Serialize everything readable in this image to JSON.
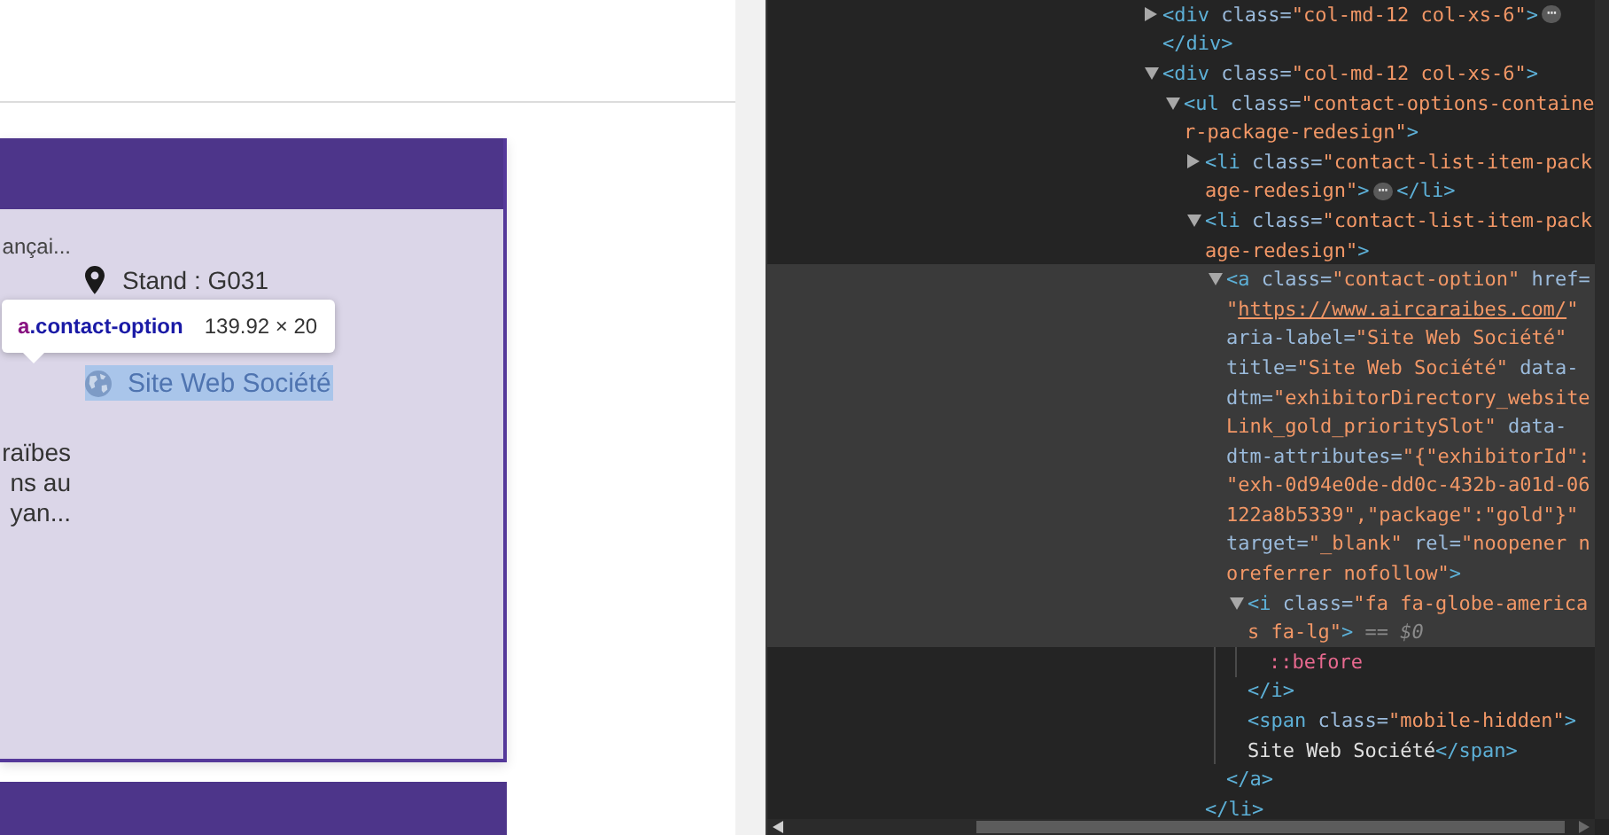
{
  "page": {
    "card": {
      "left_fragment": "ançai...",
      "description_lines": [
        "raïbes",
        "ns au",
        "yan..."
      ],
      "stand": "Stand : G031",
      "website": {
        "label": "Site Web Société",
        "highlighted": true
      }
    },
    "tooltip": {
      "selector_tag": "a",
      "selector_class": ".contact-option",
      "size": "139.92 × 20"
    }
  },
  "devtools": {
    "tree": [
      {
        "kind": "node",
        "expanded": false,
        "highlighted": false,
        "lines": [
          [
            {
              "kind": "tag",
              "text": "<div"
            },
            {
              "kind": "attr",
              "text": " class="
            },
            {
              "kind": "value",
              "text": "\"col-md-12 col-xs-6\""
            },
            {
              "kind": "tag",
              "text": ">"
            },
            {
              "kind": "badge",
              "text": "⋯"
            }
          ],
          [
            {
              "kind": "tag",
              "text": "</div>"
            }
          ]
        ]
      },
      {
        "kind": "node",
        "expanded": true,
        "highlighted": false,
        "lines": [
          [
            {
              "kind": "tag",
              "text": "<div"
            },
            {
              "kind": "attr",
              "text": " class="
            },
            {
              "kind": "value",
              "text": "\"col-md-12 col-xs-6\""
            },
            {
              "kind": "tag",
              "text": ">"
            }
          ]
        ],
        "children": [
          {
            "kind": "node",
            "expanded": true,
            "highlighted": false,
            "lines": [
              [
                {
                  "kind": "tag",
                  "text": "<ul"
                },
                {
                  "kind": "attr",
                  "text": " class="
                },
                {
                  "kind": "value",
                  "text": "\"contact-options-containe"
                }
              ],
              [
                {
                  "kind": "value",
                  "text": "r-package-redesign\""
                },
                {
                  "kind": "tag",
                  "text": ">"
                }
              ]
            ],
            "children": [
              {
                "kind": "node",
                "expanded": false,
                "highlighted": false,
                "lines": [
                  [
                    {
                      "kind": "tag",
                      "text": "<li"
                    },
                    {
                      "kind": "attr",
                      "text": " class="
                    },
                    {
                      "kind": "value",
                      "text": "\"contact-list-item-pack"
                    }
                  ],
                  [
                    {
                      "kind": "value",
                      "text": "age-redesign\""
                    },
                    {
                      "kind": "tag",
                      "text": ">"
                    },
                    {
                      "kind": "badge",
                      "text": "⋯"
                    },
                    {
                      "kind": "tag",
                      "text": "</li>"
                    }
                  ]
                ]
              },
              {
                "kind": "node",
                "expanded": true,
                "highlighted": false,
                "lines": [
                  [
                    {
                      "kind": "tag",
                      "text": "<li"
                    },
                    {
                      "kind": "attr",
                      "text": " class="
                    },
                    {
                      "kind": "value",
                      "text": "\"contact-list-item-pack"
                    }
                  ],
                  [
                    {
                      "kind": "value",
                      "text": "age-redesign\""
                    },
                    {
                      "kind": "tag",
                      "text": ">"
                    }
                  ]
                ],
                "children": [
                  {
                    "kind": "node",
                    "expanded": true,
                    "highlighted": true,
                    "lines": [
                      [
                        {
                          "kind": "tag",
                          "text": "<a"
                        },
                        {
                          "kind": "attr",
                          "text": " class="
                        },
                        {
                          "kind": "value",
                          "text": "\"contact-option\""
                        },
                        {
                          "kind": "attr",
                          "text": " href="
                        }
                      ],
                      [
                        {
                          "kind": "value",
                          "text": "\""
                        },
                        {
                          "kind": "link",
                          "text": "https://www.aircaraibes.com/"
                        },
                        {
                          "kind": "value",
                          "text": "\""
                        }
                      ],
                      [
                        {
                          "kind": "attr",
                          "text": "aria-label="
                        },
                        {
                          "kind": "value",
                          "text": "\"Site Web Société\""
                        }
                      ],
                      [
                        {
                          "kind": "attr",
                          "text": "title="
                        },
                        {
                          "kind": "value",
                          "text": "\"Site Web Société\""
                        },
                        {
                          "kind": "attr",
                          "text": " data-"
                        }
                      ],
                      [
                        {
                          "kind": "attr",
                          "text": "dtm="
                        },
                        {
                          "kind": "value",
                          "text": "\"exhibitorDirectory_website"
                        }
                      ],
                      [
                        {
                          "kind": "value",
                          "text": "Link_gold_prioritySlot\""
                        },
                        {
                          "kind": "attr",
                          "text": " data-"
                        }
                      ],
                      [
                        {
                          "kind": "attr",
                          "text": "dtm-attributes="
                        },
                        {
                          "kind": "value",
                          "text": "\"{\"exhibitorId\":"
                        }
                      ],
                      [
                        {
                          "kind": "value",
                          "text": "\"exh-0d94e0de-dd0c-432b-a01d-06"
                        }
                      ],
                      [
                        {
                          "kind": "value",
                          "text": "122a8b5339\",\"package\":\"gold\"}\""
                        }
                      ],
                      [
                        {
                          "kind": "attr",
                          "text": "target="
                        },
                        {
                          "kind": "value",
                          "text": "\"_blank\""
                        },
                        {
                          "kind": "attr",
                          "text": " rel="
                        },
                        {
                          "kind": "value",
                          "text": "\"noopener n"
                        }
                      ],
                      [
                        {
                          "kind": "value",
                          "text": "oreferrer nofollow\""
                        },
                        {
                          "kind": "tag",
                          "text": ">"
                        }
                      ]
                    ],
                    "children": [
                      {
                        "kind": "node",
                        "expanded": true,
                        "highlighted": true,
                        "lines": [
                          [
                            {
                              "kind": "tag",
                              "text": "<i"
                            },
                            {
                              "kind": "attr",
                              "text": " class="
                            },
                            {
                              "kind": "value",
                              "text": "\"fa fa-globe-america"
                            }
                          ],
                          [
                            {
                              "kind": "value",
                              "text": "s fa-lg\""
                            },
                            {
                              "kind": "tag",
                              "text": ">"
                            },
                            {
                              "kind": "muted",
                              "text": " == $0"
                            }
                          ]
                        ],
                        "children": [
                          {
                            "kind": "leaf",
                            "highlighted": false,
                            "lines": [
                              [
                                {
                                  "kind": "pseudo",
                                  "text": "::before"
                                }
                              ]
                            ]
                          }
                        ],
                        "closing": [
                          [
                            {
                              "kind": "tag",
                              "text": "</i>"
                            }
                          ]
                        ]
                      },
                      {
                        "kind": "leaf",
                        "highlighted": false,
                        "lines": [
                          [
                            {
                              "kind": "tag",
                              "text": "<span"
                            },
                            {
                              "kind": "attr",
                              "text": " class="
                            },
                            {
                              "kind": "value",
                              "text": "\"mobile-hidden\""
                            },
                            {
                              "kind": "tag",
                              "text": ">"
                            }
                          ],
                          [
                            {
                              "kind": "text",
                              "text": "Site Web Société"
                            },
                            {
                              "kind": "tag",
                              "text": "</span>"
                            }
                          ]
                        ]
                      }
                    ],
                    "closing": [
                      [
                        {
                          "kind": "tag",
                          "text": "</a>"
                        }
                      ]
                    ]
                  }
                ],
                "closing": [
                  [
                    {
                      "kind": "tag",
                      "text": "</li>"
                    }
                  ]
                ]
              }
            ]
          }
        ]
      }
    ]
  }
}
